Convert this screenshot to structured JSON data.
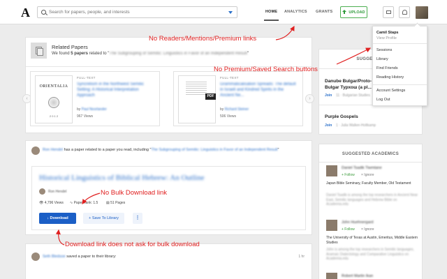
{
  "nav": {
    "logo": "A",
    "search_placeholder": "Search for papers, people, and interests",
    "home": "HOME",
    "analytics": "ANALYTICS",
    "grants": "GRANTS",
    "upload": "UPLOAD"
  },
  "dropdown": {
    "name": "Camil Staps",
    "view_profile": "View Profile",
    "items": [
      "Sessions",
      "Library",
      "Find Friends",
      "Reading History",
      "Account Settings",
      "Log Out"
    ]
  },
  "related": {
    "title": "Related Papers",
    "sub_prefix": "We found ",
    "sub_count": "5 papers",
    "sub_mid": " related to \"",
    "sub_paper": "The Subgrouping of Semitic: Linguistics in Favor of an Independent Result",
    "sub_end": "\"",
    "papers": [
      {
        "label": "FULL-TEXT",
        "thumb_title": "ORIENTALIA",
        "thumb_year": "2 0 1 2",
        "title": "Syncretism in the Northwest Semitic Setting: A Historical Interpretation Approach",
        "by_prefix": "by ",
        "author": "Paul Noorlander",
        "views": "967 Views"
      },
      {
        "label": "FULL-TEXT",
        "badge": "PDF",
        "title": "Grammaticalisation Spreads: The default in Israeli and Kindred Spirits in the Ancient Ne...",
        "by_prefix": "by ",
        "author": "Richard Steiner",
        "views": "506 Views"
      }
    ]
  },
  "feed": {
    "actor": "Ron Hendel",
    "text_mid": " has a paper related to a paper you read, including \"",
    "ref_paper": "The Subgrouping of Semitic: Linguistics in Favor of an Independent Result",
    "text_end": "\"",
    "paper_title": "Historical Linguistics of Biblical Hebrew: An Outline",
    "paper_author": "Ron Hendel",
    "views": "4,796 Views",
    "paperrank": "PaperRank: 1.5",
    "pages": "51 Pages",
    "download": "Download",
    "save": "Save To Library",
    "more": "⋮"
  },
  "feed2": {
    "actor": "Seth Bledsoe",
    "text": " saved a paper to their library:",
    "time": "1 hr"
  },
  "suggested": {
    "title": "SUGGESTED",
    "items": [
      {
        "name": "Danube Bulgar/Proto-",
        "name2": "Bulgar Турхош (a pl...",
        "join": "Join",
        "meta": "11 · Bulgarian Studies"
      },
      {
        "name": "Purple Gospels",
        "join": "Join",
        "meta": "1 · Julia Walker-Holtkamp"
      }
    ]
  },
  "academics": {
    "title": "SUGGESTED ACADEMICS",
    "follow": "+ Follow",
    "ignore": "× Ignore",
    "people": [
      {
        "name": "Daniel Tsadik Tiwmtane",
        "desc": "Japan Bible Seminary, Faculty Member, Old Testament",
        "blur": "Daniel Tsadik is among the top researchers in Ancient Near East, Semitic languages and Hebrew Bible on Academia.edu"
      },
      {
        "name": "John Huehnergard",
        "desc": "The University of Texas at Austin, Emeritus, Middle Eastern Studies",
        "blur": "John is among the top researchers in Semitic languages, Aramaic Dialectology and Comparative Linguistics on Academia.edu"
      },
      {
        "name": "Robert Martin Ikan"
      }
    ]
  },
  "annotations": {
    "a1": "No Readers/Mentions/Premium links",
    "a2": "No Premium/Saved Search buttons",
    "a3": "No Bulk Download link",
    "a4": "Download link does not ask for bulk download"
  },
  "colors": {
    "annotation": "#e02020",
    "brand_blue": "#1b5fc6",
    "upload_green": "#2e9a3a"
  }
}
